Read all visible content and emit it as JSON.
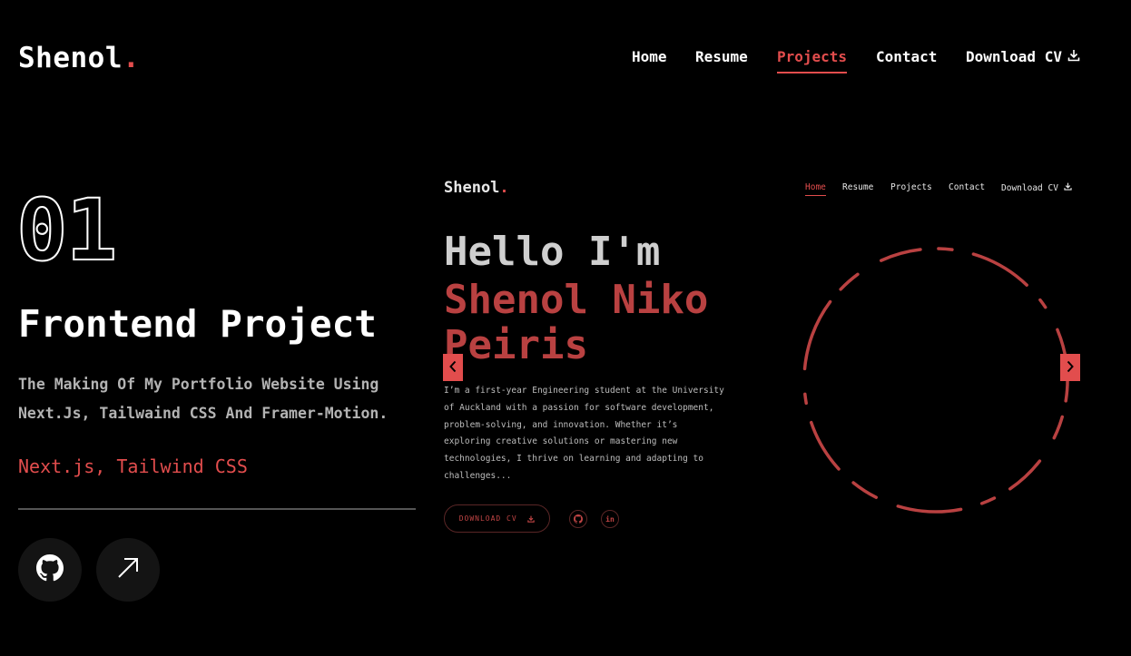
{
  "header": {
    "logo": {
      "text": "Shenol",
      "dot": "."
    },
    "nav": [
      {
        "label": "Home"
      },
      {
        "label": "Resume"
      },
      {
        "label": "Projects",
        "active": true
      },
      {
        "label": "Contact"
      }
    ],
    "download": {
      "label": "Download CV",
      "icon": "download-icon"
    }
  },
  "project": {
    "number": "01",
    "title": "Frontend Project",
    "description": "The Making Of My Portfolio Website Using Next.Js, Tailwaind CSS And Framer-Motion.",
    "stack": "Next.js, Tailwind CSS",
    "links": [
      {
        "icon": "github-icon"
      },
      {
        "icon": "arrow-up-right-icon"
      }
    ]
  },
  "preview": {
    "logo": {
      "text": "Shenol",
      "dot": "."
    },
    "nav": [
      {
        "label": "Home",
        "active": true
      },
      {
        "label": "Resume"
      },
      {
        "label": "Projects"
      },
      {
        "label": "Contact"
      },
      {
        "label": "Download CV"
      }
    ],
    "greeting": "Hello I'm",
    "name": "Shenol Niko Peiris",
    "bio": "I’m a first-year Engineering student at the University of Auckland with a passion for software development, problem-solving, and innovation. Whether it’s exploring creative solutions or mastering new technologies, I thrive on learning and adapting to challenges...",
    "download_button": "DOWNLOAD CV",
    "socials": [
      {
        "icon": "github-icon"
      },
      {
        "label": "in",
        "icon": "linkedin-icon"
      }
    ]
  },
  "slider": {
    "prev_icon": "chevron-left-icon",
    "next_icon": "chevron-right-icon"
  },
  "colors": {
    "accent": "#e24d4d",
    "background": "#000000",
    "muted_accent": "#b94141"
  }
}
